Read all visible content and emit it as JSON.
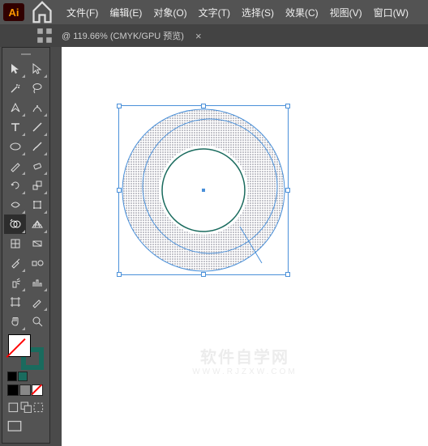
{
  "app": {
    "logo": "Ai"
  },
  "menu": {
    "file": "文件(F)",
    "edit": "编辑(E)",
    "object": "对象(O)",
    "type": "文字(T)",
    "select": "选择(S)",
    "effect": "效果(C)",
    "view": "视图(V)",
    "window": "窗口(W)"
  },
  "tab": {
    "title": "@ 119.66% (CMYK/GPU 预览)",
    "close": "×"
  },
  "colors": {
    "stroke_hex": "#1a6b5e",
    "selection_hex": "#4a90d9",
    "app_orange": "#ff9a00"
  },
  "fill_stroke": {
    "fill": "none",
    "stroke": "#1a6b5e"
  },
  "swatches": [
    "#000000",
    "#888888",
    "#ffffff"
  ],
  "watermark": {
    "line1": "软件自学网",
    "line2": "WWW.RJZXW.COM"
  },
  "icons": {
    "home": "home-icon",
    "tools": [
      [
        "selection",
        "direct-selection"
      ],
      [
        "magic-wand",
        "lasso"
      ],
      [
        "pen",
        "curvature"
      ],
      [
        "type",
        "line-segment"
      ],
      [
        "rectangle",
        "paintbrush"
      ],
      [
        "shaper",
        "eraser"
      ],
      [
        "rotate",
        "scale"
      ],
      [
        "width",
        "free-transform"
      ],
      [
        "shape-builder",
        "perspective-grid"
      ],
      [
        "mesh",
        "gradient"
      ],
      [
        "eyedropper",
        "blend"
      ],
      [
        "symbol-sprayer",
        "column-graph"
      ],
      [
        "artboard",
        "slice"
      ],
      [
        "hand",
        "zoom"
      ]
    ]
  }
}
